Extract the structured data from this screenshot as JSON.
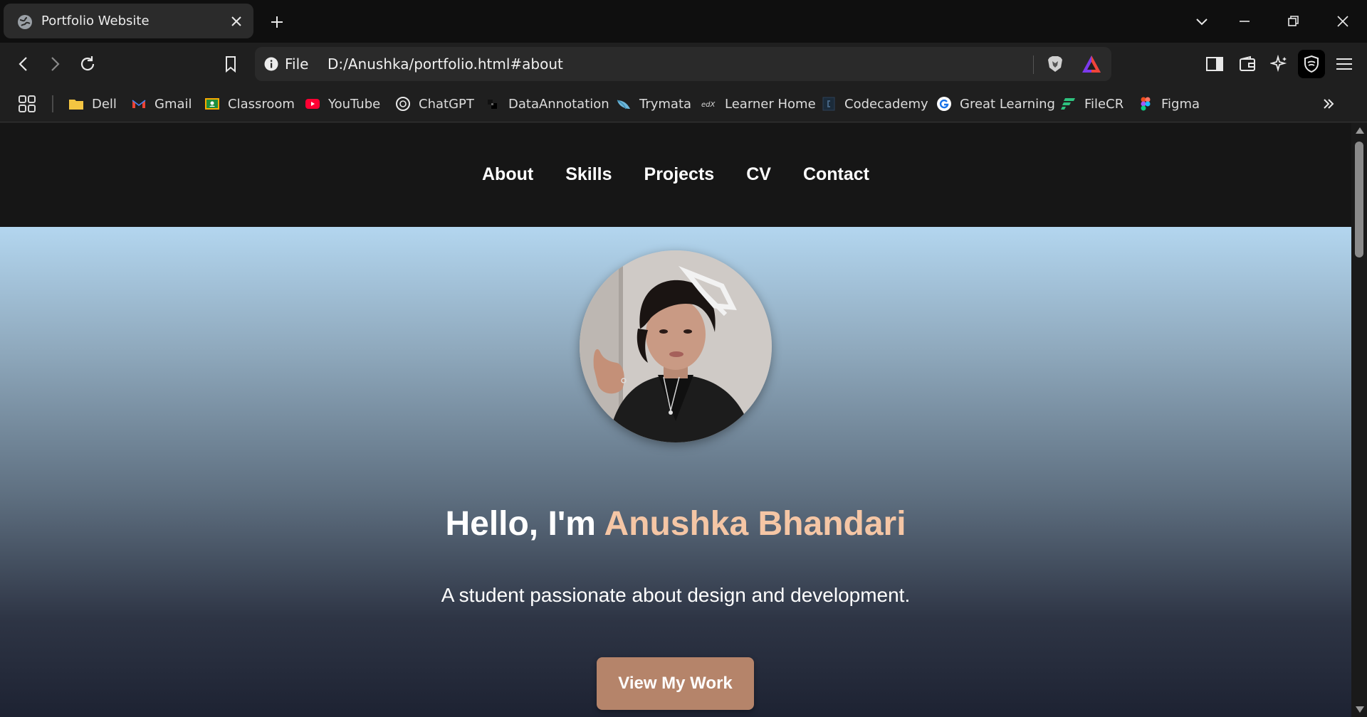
{
  "browser": {
    "tab": {
      "title": "Portfolio Website"
    },
    "omnibox": {
      "scheme_label": "File",
      "url": "D:/Anushka/portfolio.html#about"
    },
    "bookmarks": [
      {
        "label": "Dell",
        "icon": "folder-icon"
      },
      {
        "label": "Gmail",
        "icon": "gmail-icon"
      },
      {
        "label": "Classroom",
        "icon": "classroom-icon"
      },
      {
        "label": "YouTube",
        "icon": "youtube-icon"
      },
      {
        "label": "ChatGPT",
        "icon": "chatgpt-icon"
      },
      {
        "label": "DataAnnotation",
        "icon": "dataannotation-icon"
      },
      {
        "label": "Trymata",
        "icon": "trymata-icon"
      },
      {
        "label": "Learner Home",
        "icon": "edx-icon"
      },
      {
        "label": "Codecademy",
        "icon": "codecademy-icon"
      },
      {
        "label": "Great Learning",
        "icon": "great-learning-icon"
      },
      {
        "label": "FileCR",
        "icon": "filecr-icon"
      },
      {
        "label": "Figma",
        "icon": "figma-icon"
      }
    ]
  },
  "site": {
    "nav": [
      "About",
      "Skills",
      "Projects",
      "CV",
      "Contact"
    ],
    "hero": {
      "greeting": "Hello, I'm ",
      "name": "Anushka Bhandari",
      "subtitle": "A student passionate about design and development.",
      "cta_label": "View My Work"
    }
  },
  "colors": {
    "accent_name": "#f5c6a5",
    "cta_background": "#b5846a",
    "nav_background": "#161616"
  }
}
